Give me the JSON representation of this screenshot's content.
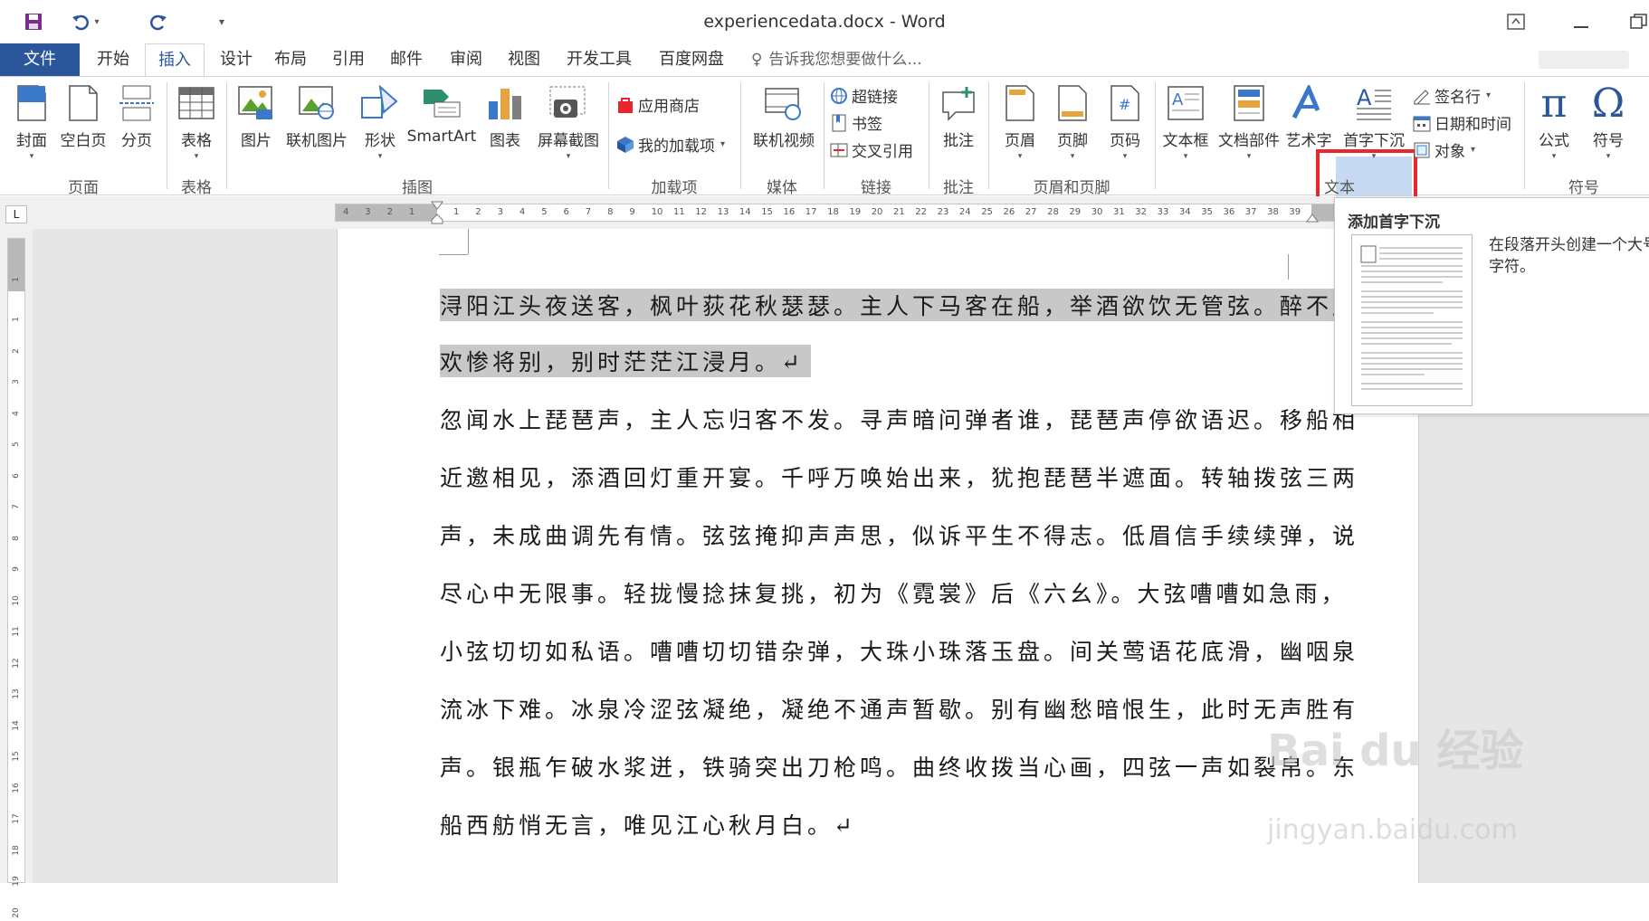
{
  "title_bar": {
    "title": "experiencedata.docx - Word"
  },
  "tabs": [
    {
      "label": "文件"
    },
    {
      "label": "开始"
    },
    {
      "label": "插入"
    },
    {
      "label": "设计"
    },
    {
      "label": "布局"
    },
    {
      "label": "引用"
    },
    {
      "label": "邮件"
    },
    {
      "label": "审阅"
    },
    {
      "label": "视图"
    },
    {
      "label": "开发工具"
    },
    {
      "label": "百度网盘"
    }
  ],
  "tell_me": "告诉我您想要做什么...",
  "ribbon": {
    "cover": "封面",
    "blank_page": "空白页",
    "page_break": "分页",
    "table": "表格",
    "picture": "图片",
    "online_picture": "联机图片",
    "shapes": "形状",
    "smartart": "SmartArt",
    "chart": "图表",
    "screenshot": "屏幕截图",
    "app_store": "应用商店",
    "my_addins": "我的加载项",
    "online_video": "联机视频",
    "hyperlink": "超链接",
    "bookmark": "书签",
    "cross_ref": "交叉引用",
    "comment": "批注",
    "header": "页眉",
    "footer": "页脚",
    "page_number": "页码",
    "textbox": "文本框",
    "quick_parts": "文档部件",
    "wordart": "艺术字",
    "drop_cap": "首字下沉",
    "signature_line": "签名行",
    "date_time": "日期和时间",
    "object": "对象",
    "equation": "公式",
    "symbol": "符号",
    "groups": {
      "pages": "页面",
      "tables": "表格",
      "illustrations": "插图",
      "addins": "加载项",
      "media": "媒体",
      "links": "链接",
      "comments": "批注",
      "header_footer": "页眉和页脚",
      "text": "文本",
      "symbols": "符号"
    }
  },
  "tooltip": {
    "title": "添加首字下沉",
    "description": "在段落开头创建一个大号字符。"
  },
  "document": {
    "lines": [
      "浔阳江头夜送客，枫叶荻花秋瑟瑟。主人下马客在船，举酒欲饮无管弦。醉不成",
      "欢惨将别，别时茫茫江浸月。↵",
      "忽闻水上琵琶声，主人忘归客不发。寻声暗问弹者谁，琵琶声停欲语迟。移船相",
      "近邀相见，添酒回灯重开宴。千呼万唤始出来，犹抱琵琶半遮面。转轴拨弦三两",
      "声，未成曲调先有情。弦弦掩抑声声思，似诉平生不得志。低眉信手续续弹，说",
      "尽心中无限事。轻拢慢捻抹复挑，初为《霓裳》后《六幺》。大弦嘈嘈如急雨，",
      "小弦切切如私语。嘈嘈切切错杂弹，大珠小珠落玉盘。间关莺语花底滑，幽咽泉",
      "流冰下难。冰泉冷涩弦凝绝，凝绝不通声暂歇。别有幽愁暗恨生，此时无声胜有",
      "声。银瓶乍破水浆迸，铁骑突出刀枪鸣。曲终收拨当心画，四弦一声如裂帛。东",
      "船西舫悄无言，唯见江心秋月白。↵"
    ]
  },
  "ruler": {
    "h_left": [
      "4",
      "3",
      "2",
      "1"
    ],
    "h_right": [
      "1",
      "2",
      "3",
      "4",
      "5",
      "6",
      "7",
      "8",
      "9",
      "10",
      "11",
      "12",
      "13",
      "14",
      "15",
      "16",
      "17",
      "18",
      "19",
      "20",
      "21",
      "22",
      "23",
      "24",
      "25",
      "26",
      "27",
      "28",
      "29",
      "30",
      "31",
      "32",
      "33",
      "34",
      "35",
      "36",
      "37",
      "38",
      "39"
    ],
    "v": [
      "1",
      "1",
      "2",
      "3",
      "4",
      "5",
      "6",
      "7",
      "8",
      "9",
      "10",
      "11",
      "12",
      "13",
      "14",
      "15",
      "16",
      "17",
      "18",
      "19",
      "20"
    ]
  },
  "watermark": {
    "brand": "Bai du 经验",
    "url": "jingyan.baidu.com"
  }
}
